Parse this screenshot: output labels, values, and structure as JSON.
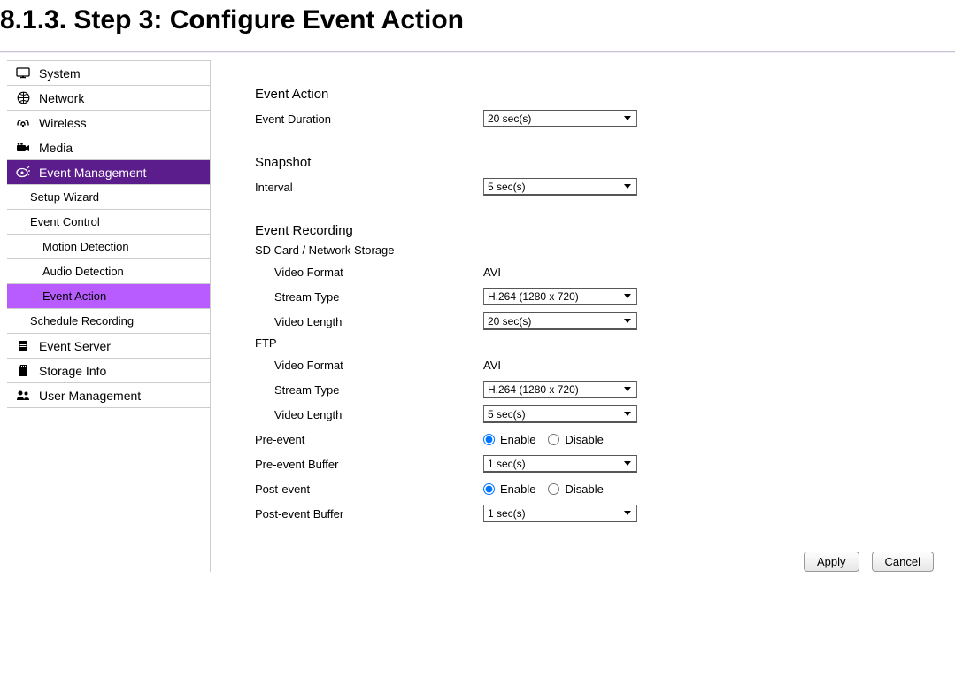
{
  "doc": {
    "heading": "8.1.3.  Step 3: Configure Event Action"
  },
  "sidebar": {
    "items": [
      {
        "label": "System"
      },
      {
        "label": "Network"
      },
      {
        "label": "Wireless"
      },
      {
        "label": "Media"
      },
      {
        "label": "Event Management"
      },
      {
        "label": "Event Server"
      },
      {
        "label": "Storage Info"
      },
      {
        "label": "User Management"
      }
    ],
    "subs": {
      "setup_wizard": "Setup Wizard",
      "event_control": "Event Control",
      "schedule_recording": "Schedule Recording"
    },
    "subsubs": {
      "motion_detection": "Motion Detection",
      "audio_detection": "Audio Detection",
      "event_action": "Event Action"
    }
  },
  "content": {
    "event_action": {
      "title": "Event Action",
      "duration_label": "Event Duration",
      "duration_value": "20 sec(s)"
    },
    "snapshot": {
      "title": "Snapshot",
      "interval_label": "Interval",
      "interval_value": "5 sec(s)"
    },
    "event_recording": {
      "title": "Event Recording",
      "sd_heading": "SD Card / Network Storage",
      "sd": {
        "video_format_label": "Video Format",
        "video_format_value": "AVI",
        "stream_type_label": "Stream Type",
        "stream_type_value": "H.264 (1280 x 720)",
        "video_length_label": "Video Length",
        "video_length_value": "20 sec(s)"
      },
      "ftp_heading": "FTP",
      "ftp": {
        "video_format_label": "Video Format",
        "video_format_value": "AVI",
        "stream_type_label": "Stream Type",
        "stream_type_value": "H.264 (1280 x 720)",
        "video_length_label": "Video Length",
        "video_length_value": "5 sec(s)"
      },
      "pre_event_label": "Pre-event",
      "pre_event_value": "enable",
      "pre_event_buffer_label": "Pre-event Buffer",
      "pre_event_buffer_value": "1 sec(s)",
      "post_event_label": "Post-event",
      "post_event_value": "enable",
      "post_event_buffer_label": "Post-event Buffer",
      "post_event_buffer_value": "1 sec(s)",
      "radio": {
        "enable": "Enable",
        "disable": "Disable"
      }
    }
  },
  "buttons": {
    "apply": "Apply",
    "cancel": "Cancel"
  }
}
